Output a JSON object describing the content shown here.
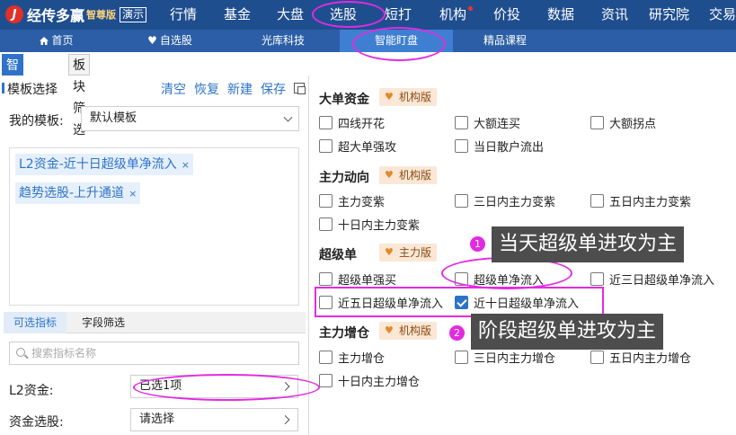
{
  "app": {
    "brand": "经传多赢",
    "edition": "智尊版",
    "demo_label": "演示"
  },
  "top_nav": [
    "行情",
    "基金",
    "大盘",
    "选股",
    "短打",
    "机构",
    "价投",
    "数据",
    "资讯",
    "研究院",
    "交易"
  ],
  "sub_nav": [
    "首页",
    "自选股",
    "光库科技",
    "智能盯盘",
    "精品课程"
  ],
  "left_tabs": [
    "智能盯盘",
    "板块筛选"
  ],
  "template": {
    "heading": "模板选择",
    "actions": [
      "清空",
      "恢复",
      "新建",
      "保存"
    ],
    "my_label": "我的模板:",
    "my_value": "默认模板",
    "tags": [
      "L2资金-近十日超级单净流入",
      "趋势选股-上升通道"
    ],
    "tag_remove": "×"
  },
  "indicator_tabs": [
    "可选指标",
    "字段筛选"
  ],
  "search_placeholder": "搜索指标名称",
  "fields": [
    {
      "label": "L2资金:",
      "value": "已选1项"
    },
    {
      "label": "资金选股:",
      "value": "请选择"
    }
  ],
  "sections": [
    {
      "title": "大单资金",
      "badge": "机构版",
      "options": [
        {
          "label": "四线开花",
          "checked": false
        },
        {
          "label": "大额连买",
          "checked": false
        },
        {
          "label": "大额拐点",
          "checked": false
        },
        {
          "label": "超大单强攻",
          "checked": false
        },
        {
          "label": "当日散户流出",
          "checked": false
        }
      ]
    },
    {
      "title": "主力动向",
      "badge": "机构版",
      "options": [
        {
          "label": "主力变紫",
          "checked": false
        },
        {
          "label": "三日内主力变紫",
          "checked": false
        },
        {
          "label": "五日内主力变紫",
          "checked": false
        },
        {
          "label": "十日内主力变紫",
          "checked": false
        }
      ]
    },
    {
      "title": "超级单",
      "badge": "主力版",
      "options": [
        {
          "label": "超级单强买",
          "checked": false
        },
        {
          "label": "超级单净流入",
          "checked": false
        },
        {
          "label": "近三日超级单净流入",
          "checked": false
        },
        {
          "label": "近五日超级单净流入",
          "checked": false
        },
        {
          "label": "近十日超级单净流入",
          "checked": true
        }
      ]
    },
    {
      "title": "主力增仓",
      "badge": "机构版",
      "options": [
        {
          "label": "主力增仓",
          "checked": false
        },
        {
          "label": "三日内主力增仓",
          "checked": false
        },
        {
          "label": "五日内主力增仓",
          "checked": false
        },
        {
          "label": "十日内主力增仓",
          "checked": false
        }
      ]
    }
  ],
  "annotations": [
    {
      "number": "1",
      "text": "当天超级单进攻为主"
    },
    {
      "number": "2",
      "text": "阶段超级单进攻为主"
    }
  ],
  "colors": {
    "nav_bg": "#1f4e8f",
    "accent": "#2f73c8",
    "highlight": "#e22be0"
  }
}
